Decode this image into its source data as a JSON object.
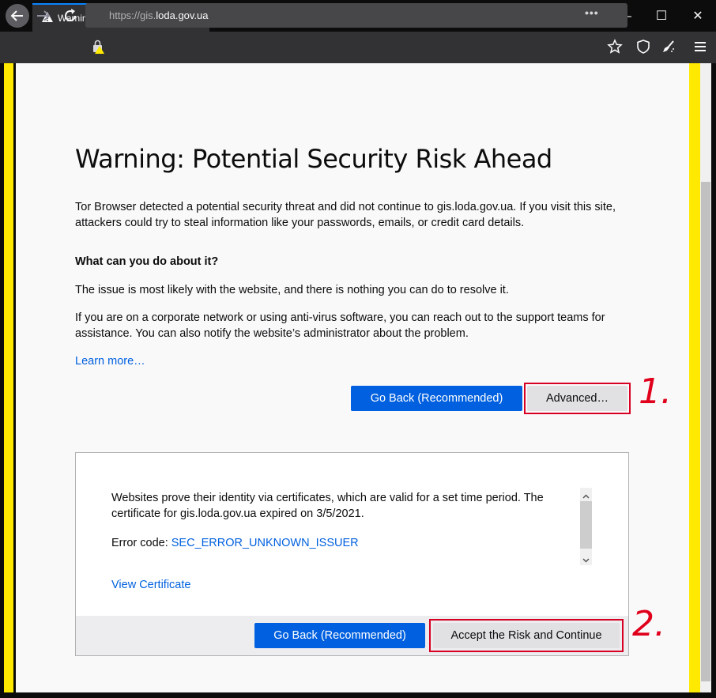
{
  "browser": {
    "tab_title": "Warning: Potential Security Risk Ahead",
    "new_tab": "+",
    "window_controls": {
      "minimize": "—",
      "maximize": "☐",
      "close": "✕"
    },
    "url_prefix": "https://gis.",
    "url_domain": "loda.gov.ua",
    "page_actions": "•••"
  },
  "page": {
    "title": "Warning: Potential Security Risk Ahead",
    "intro": "Tor Browser detected a potential security threat and did not continue to gis.loda.gov.ua. If you visit this site, attackers could try to steal information like your passwords, emails, or credit card details.",
    "what_heading": "What can you do about it?",
    "issue_text": "The issue is most likely with the website, and there is nothing you can do to resolve it.",
    "corporate_text": "If you are on a corporate network or using anti-virus software, you can reach out to the support teams for assistance. You can also notify the website’s administrator about the problem.",
    "learn_more": "Learn more…",
    "go_back": "Go Back (Recommended)",
    "advanced": "Advanced…"
  },
  "advanced_panel": {
    "cert_text": "Websites prove their identity via certificates, which are valid for a set time period. The certificate for gis.loda.gov.ua expired on 3/5/2021.",
    "error_label": "Error code: ",
    "error_code": "SEC_ERROR_UNKNOWN_ISSUER",
    "view_cert": "View Certificate",
    "go_back": "Go Back (Recommended)",
    "accept": "Accept the Risk and Continue"
  },
  "annotations": {
    "step1": "1.",
    "step2": "2."
  },
  "colors": {
    "accent": "#0060df",
    "annotation_red": "#d70022",
    "border_yellow": "#ffe900"
  }
}
